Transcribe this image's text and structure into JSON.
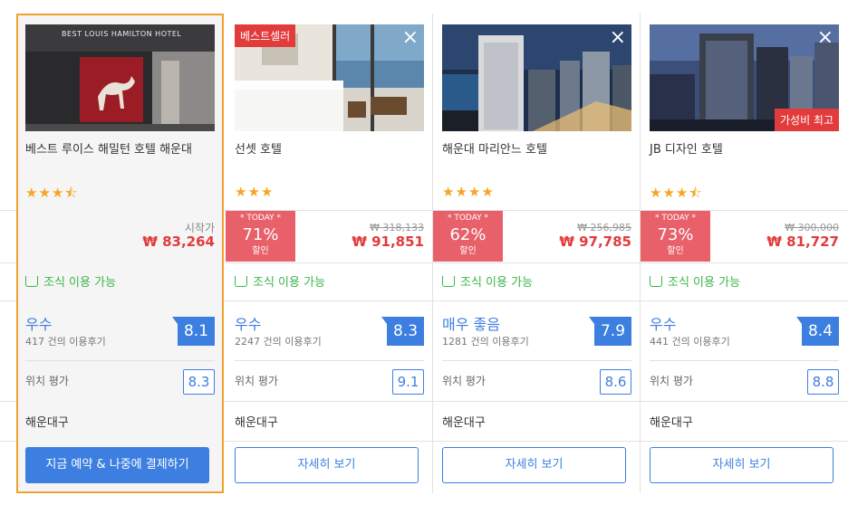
{
  "colors": {
    "accent": "#3d7fe0",
    "sale": "#e23b3b",
    "deal_bg": "#e8616a",
    "selected_border": "#f0a22e",
    "breakfast": "#3bb54a"
  },
  "hotels": [
    {
      "name": "베스트 루이스 해밀턴 호텔 해운대",
      "stars": "★★★⯪",
      "start_label": "시작가",
      "price": "₩ 83,264",
      "breakfast": "조식 이용 가능",
      "grade": "우수",
      "reviews": "417 건의 이용후기",
      "score": "8.1",
      "location_label": "위치 평가",
      "location_score": "8.3",
      "district": "해운대구",
      "button": "지금 예약 & 나중에 결제하기",
      "photo_sign": "BEST LOUIS HAMILTON HOTEL"
    },
    {
      "name": "선셋 호텔",
      "badge": "베스트셀러",
      "close": "×",
      "stars": "★★★",
      "deal_tag": "* TODAY *",
      "deal_pct": "71%",
      "deal_label": "할인",
      "orig_price": "₩ 318,133",
      "price": "₩ 91,851",
      "breakfast": "조식 이용 가능",
      "grade": "우수",
      "reviews": "2247 건의 이용후기",
      "score": "8.3",
      "location_label": "위치 평가",
      "location_score": "9.1",
      "district": "해운대구",
      "button": "자세히 보기"
    },
    {
      "name": "해운대 마리안느 호텔",
      "close": "×",
      "stars": "★★★★",
      "deal_tag": "* TODAY *",
      "deal_pct": "62%",
      "deal_label": "할인",
      "orig_price": "₩ 256,985",
      "price": "₩ 97,785",
      "breakfast": "조식 이용 가능",
      "grade": "매우 좋음",
      "reviews": "1281 건의 이용후기",
      "score": "7.9",
      "location_label": "위치 평가",
      "location_score": "8.6",
      "district": "해운대구",
      "button": "자세히 보기"
    },
    {
      "name": "JB 디자인 호텔",
      "close": "×",
      "badge_br": "가성비 최고",
      "stars": "★★★⯪",
      "deal_tag": "* TODAY *",
      "deal_pct": "73%",
      "deal_label": "할인",
      "orig_price": "₩ 300,000",
      "price": "₩ 81,727",
      "breakfast": "조식 이용 가능",
      "grade": "우수",
      "reviews": "441 건의 이용후기",
      "score": "8.4",
      "location_label": "위치 평가",
      "location_score": "8.8",
      "district": "해운대구",
      "button": "자세히 보기"
    }
  ]
}
